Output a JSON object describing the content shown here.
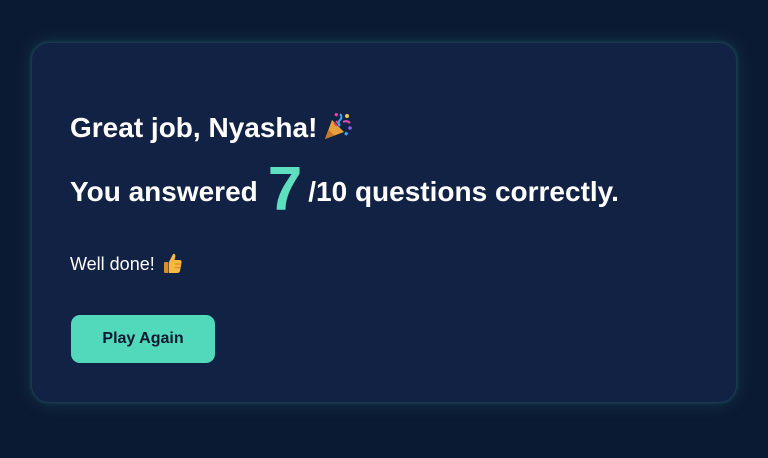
{
  "result": {
    "greeting": "Great job, Nyasha!",
    "greeting_icon": "party-popper-icon",
    "score_prefix": "You answered ",
    "score": "7",
    "score_suffix": "/10 questions correctly.",
    "feedback": "Well done!",
    "feedback_icon": "thumbs-up-icon",
    "play_again_label": "Play Again"
  },
  "colors": {
    "background": "#0b1a33",
    "card": "#112244",
    "accent": "#5ee0c0",
    "button": "#52d8bb",
    "text": "#ffffff"
  }
}
